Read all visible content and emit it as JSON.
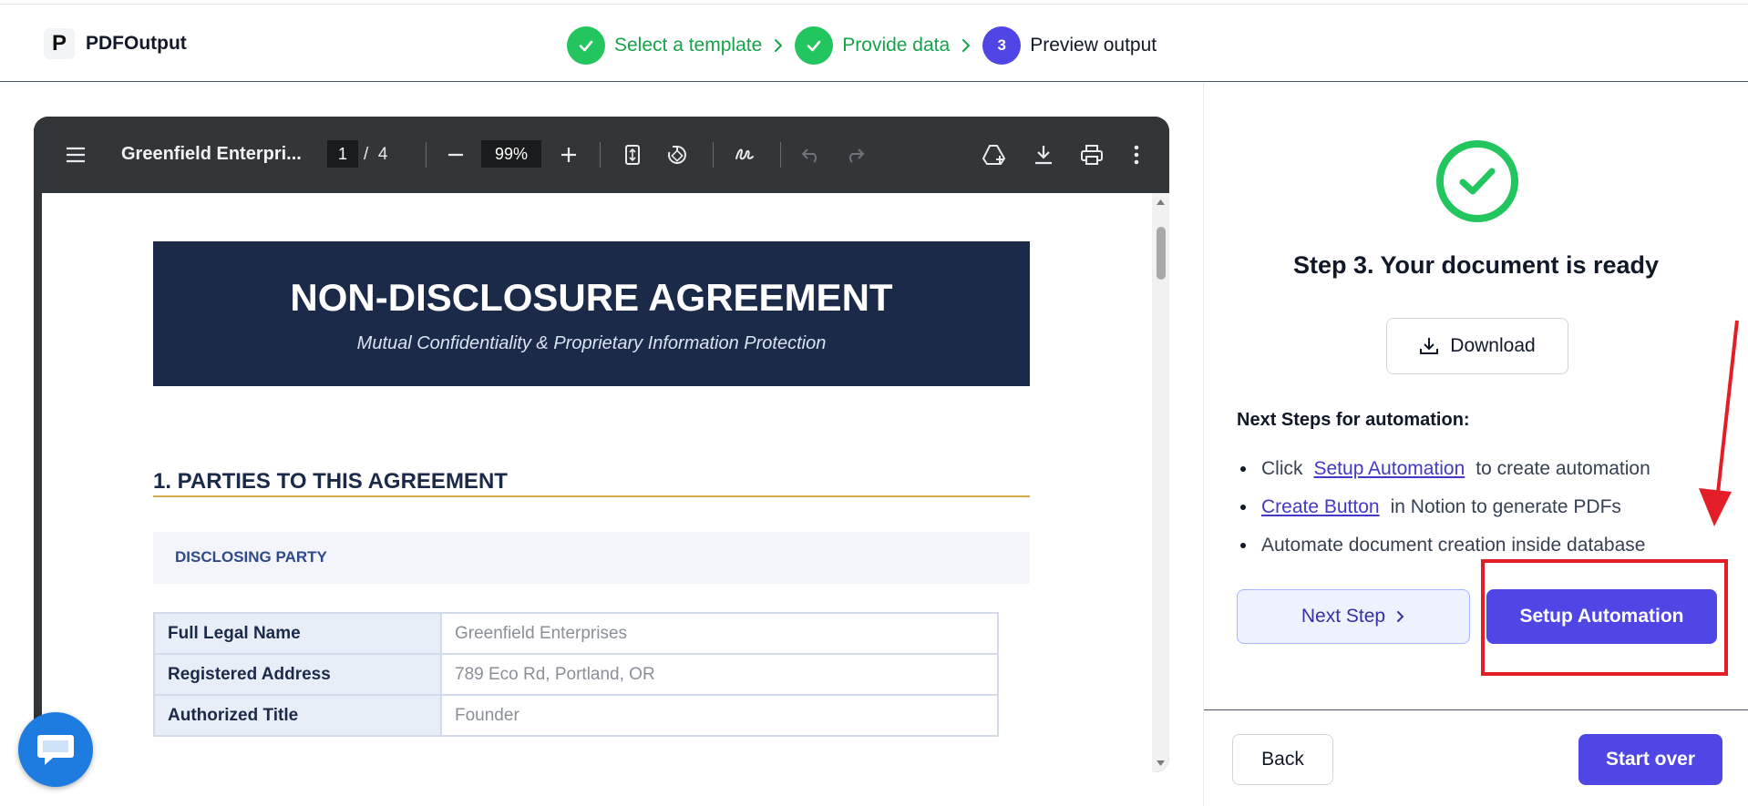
{
  "app": {
    "logo_letter": "P",
    "name": "PDFOutput"
  },
  "stepper": [
    {
      "label": "Select a template",
      "state": "done"
    },
    {
      "label": "Provide data",
      "state": "done"
    },
    {
      "number": "3",
      "label": "Preview output",
      "state": "current"
    }
  ],
  "viewer": {
    "doc_title": "Greenfield Enterpri...",
    "current_page": "1",
    "page_separator": "/",
    "total_pages": "4",
    "zoom": "99%",
    "icons": [
      "menu-icon",
      "zoom-out-icon",
      "zoom-in-icon",
      "fit-page-icon",
      "rotate-icon",
      "draw-icon",
      "undo-icon",
      "redo-icon",
      "drive-add-icon",
      "download-icon",
      "print-icon",
      "more-vert-icon"
    ]
  },
  "document": {
    "title": "NON-DISCLOSURE AGREEMENT",
    "subtitle": "Mutual Confidentiality & Proprietary Information Protection",
    "section_heading": "1.  PARTIES TO THIS AGREEMENT",
    "party_label": "DISCLOSING PARTY",
    "rows": [
      {
        "key": "Full Legal Name",
        "value": "Greenfield Enterprises"
      },
      {
        "key": "Registered Address",
        "value": "789 Eco Rd, Portland, OR"
      },
      {
        "key": "Authorized Title",
        "value": "Founder"
      }
    ]
  },
  "panel": {
    "ready_title": "Step 3. Your document is ready",
    "download_label": "Download",
    "next_steps_title": "Next Steps for automation:",
    "bullet1_prefix": "Click",
    "bullet1_link": "Setup Automation",
    "bullet1_suffix": "to create automation",
    "bullet2_link": "Create Button",
    "bullet2_suffix": "in Notion to generate PDFs",
    "bullet3": "Automate document creation inside database",
    "next_step_label": "Next Step",
    "setup_label": "Setup Automation",
    "back_label": "Back",
    "start_over_label": "Start over"
  },
  "colors": {
    "accent": "#4f46e5",
    "success": "#22c55e",
    "annotation": "#e41e26",
    "doc_navy": "#1c2a4a",
    "doc_gold": "#d4aa4a"
  }
}
